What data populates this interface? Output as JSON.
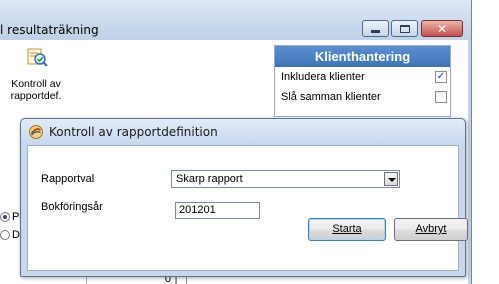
{
  "main_window": {
    "title": "l resultaträkning",
    "caption_buttons": {
      "minimize_icon": "minimize-icon",
      "maximize_icon": "maximize-icon",
      "close_icon": "close-icon",
      "close_glyph": "✕"
    }
  },
  "toolbar": {
    "report_check": {
      "icon": "magnifier-check-icon",
      "label_line1": "Kontroll av",
      "label_line2": "rapportdef."
    }
  },
  "client_panel": {
    "title": "Klienthantering",
    "rows": [
      {
        "label": "Inkludera klienter",
        "checked": true
      },
      {
        "label": "Slå samman klienter",
        "checked": false
      }
    ]
  },
  "radios": [
    {
      "label": "Pe",
      "selected": true
    },
    {
      "label": "Da",
      "selected": false
    }
  ],
  "bottom_field": {
    "value": "0"
  },
  "dialog": {
    "title": "Kontroll av rapportdefinition",
    "icon": "app-logo-icon",
    "report_label": "Rapportval",
    "report_value": "Skarp rapport",
    "year_label": "Bokföringsår",
    "year_value": "201201",
    "start_button": "Starta",
    "cancel_button": "Avbryt"
  },
  "colors": {
    "frame": "#c3d4e8",
    "panel_header": "#4a80c4",
    "close_button": "#c75050"
  }
}
